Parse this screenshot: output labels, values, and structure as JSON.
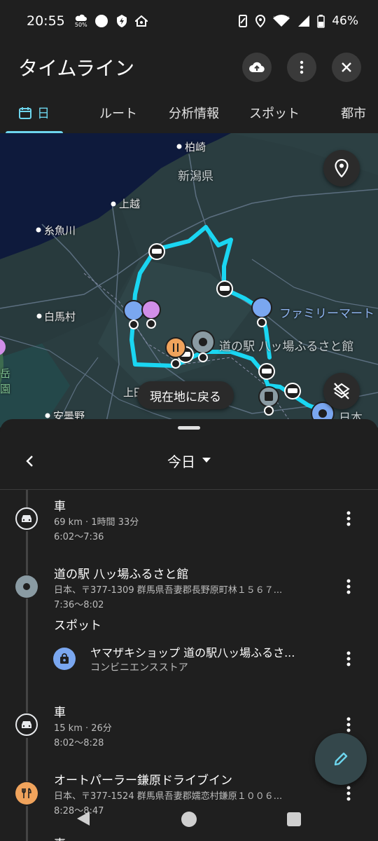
{
  "status": {
    "time": "20:55",
    "data_saver_label": "50%",
    "battery": "46%",
    "icons": [
      "weather-icon",
      "circle-icon",
      "shield-icon",
      "home-icon",
      "vibrate-icon",
      "location-icon",
      "wifi-icon",
      "signal-icon",
      "battery-icon"
    ]
  },
  "header": {
    "title": "タイムライン",
    "actions": [
      "cloud-upload-icon",
      "more-vert-icon",
      "close-icon"
    ]
  },
  "tabs": [
    {
      "label": "日",
      "active": true,
      "icon": "calendar-icon"
    },
    {
      "label": "ルート",
      "active": false
    },
    {
      "label": "分析情報",
      "active": false
    },
    {
      "label": "スポット",
      "active": false
    },
    {
      "label": "都市",
      "active": false
    }
  ],
  "map": {
    "labels": {
      "kashiwazaki": "柏崎",
      "niigata": "新潟県",
      "joetsu": "上越",
      "itoigawa": "糸魚川",
      "hakuba": "白馬村",
      "ueda": "上田",
      "azumino": "安曇野",
      "park1": "岳",
      "park2": "園",
      "familymart": "ファミリーマート",
      "michinoeki": "道の駅 八ッ場ふるさと館",
      "nihon": "日本"
    },
    "return_button": "現在地に戻る",
    "route_color": "#1ad6f2",
    "water_color": "#0d1b3e"
  },
  "sheet": {
    "date_label": "今日",
    "items": [
      {
        "type": "car",
        "title": "車",
        "sub1": "69 km · 1時間 33分",
        "sub2": "6:02〜7:36"
      },
      {
        "type": "place",
        "title": "道の駅 八ッ場ふるさと館",
        "sub1": "日本、〒377-1309 群馬県吾妻郡長野原町林１５６７...",
        "sub2": "7:36〜8:02"
      },
      {
        "type": "car",
        "title": "車",
        "sub1": "15 km · 26分",
        "sub2": "8:02〜8:28"
      },
      {
        "type": "food",
        "title": "オートパーラー鎌原ドライブイン",
        "sub1": "日本、〒377-1524 群馬県吾妻郡嬬恋村鎌原１００６...",
        "sub2": "8:28〜8:47"
      },
      {
        "type": "car",
        "title": "車"
      }
    ],
    "spot_section_label": "スポット",
    "spot": {
      "title": "ヤマザキショップ 道の駅八ッ場ふるさ...",
      "sub": "コンビニエンスストア"
    }
  },
  "fab": {
    "icon": "edit-icon"
  },
  "nav": {
    "buttons": [
      "back-triangle-icon",
      "home-circle-icon",
      "recents-square-icon"
    ]
  }
}
